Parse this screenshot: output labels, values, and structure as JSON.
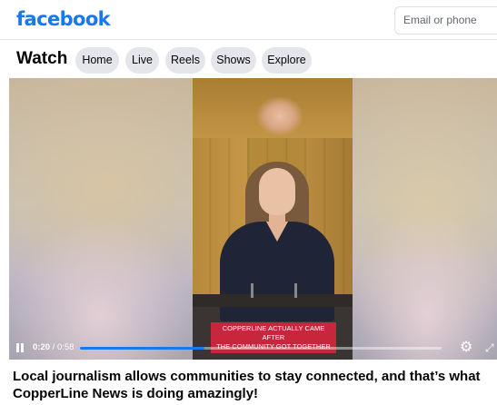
{
  "header": {
    "logo": "facebook",
    "email_placeholder": "Email or phone"
  },
  "watch_nav": {
    "title": "Watch",
    "tabs": [
      {
        "label": "Home"
      },
      {
        "label": "Live"
      },
      {
        "label": "Reels"
      },
      {
        "label": "Shows"
      },
      {
        "label": "Explore"
      }
    ]
  },
  "video": {
    "caption_line1": "COPPERLINE ACTUALLY CAME AFTER",
    "caption_line2": "THE COMMUNITY GOT TOGETHER",
    "current_time": "0:20",
    "time_separator": " / ",
    "duration": "0:58",
    "progress_fraction": 0.345,
    "icons": {
      "play_state": "pause-icon",
      "settings": "gear-icon",
      "fullscreen": "expand-icon"
    }
  },
  "post": {
    "text": "Local journalism allows communities to stay connected, and that’s what CopperLine News is doing amazingly!"
  },
  "colors": {
    "brand": "#1877f2",
    "caption_bg": "#c8263c",
    "pill_bg": "#e4e6eb"
  }
}
